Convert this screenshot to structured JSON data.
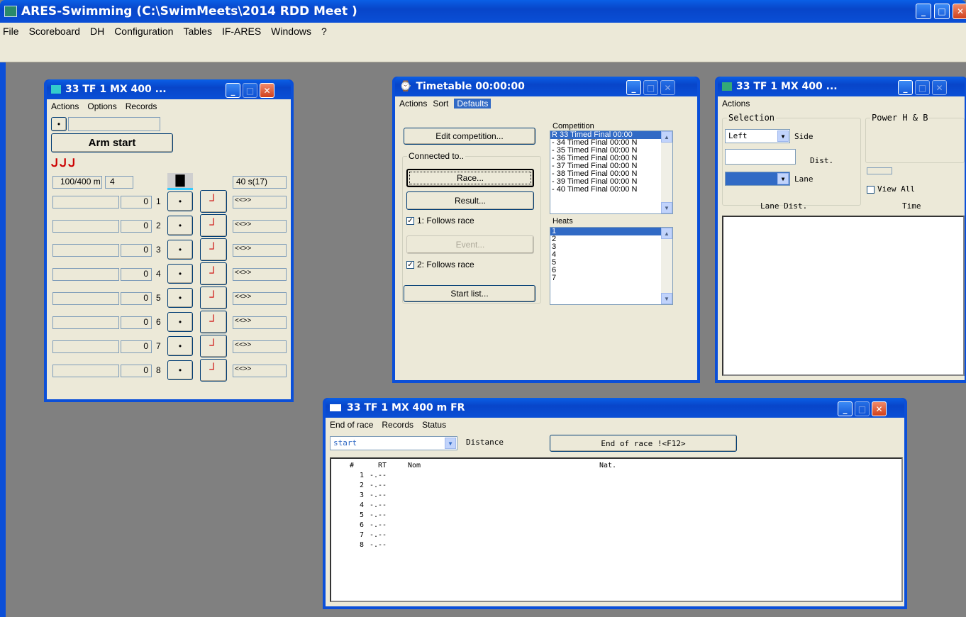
{
  "app": {
    "title": "ARES-Swimming (C:\\SwimMeets\\2014 RDD Meet )",
    "menu": [
      "File",
      "Scoreboard",
      "DH",
      "Configuration",
      "Tables",
      "IF-ARES",
      "Windows",
      "?"
    ]
  },
  "lanes_win": {
    "title": "33  TF 1  MX 400 ...",
    "menu": [
      "Actions",
      "Options",
      "Records"
    ],
    "arm_label": "Arm start",
    "dist": "100/400  m",
    "count": "4",
    "time": "40 s(17)",
    "lanes": [
      {
        "n": "1",
        "v": "0",
        "r": "<<>>"
      },
      {
        "n": "2",
        "v": "0",
        "r": "<<>>"
      },
      {
        "n": "3",
        "v": "0",
        "r": "<<>>"
      },
      {
        "n": "4",
        "v": "0",
        "r": "<<>>"
      },
      {
        "n": "5",
        "v": "0",
        "r": "<<>>"
      },
      {
        "n": "6",
        "v": "0",
        "r": "<<>>"
      },
      {
        "n": "7",
        "v": "0",
        "r": "<<>>"
      },
      {
        "n": "8",
        "v": "0",
        "r": "<<>>"
      }
    ]
  },
  "timetable": {
    "title": "Timetable  00:00:00",
    "menu": [
      "Actions",
      "Sort",
      "Defaults"
    ],
    "edit_btn": "Edit competition...",
    "connected": "Connected to..",
    "race_btn": "Race...",
    "result_btn": "Result...",
    "follows1": "1: Follows race",
    "event_btn": "Event...",
    "follows2": "2: Follows race",
    "start_btn": "Start list...",
    "competition_label": "Competition",
    "competitions": [
      "R 33 Timed Final 00:00",
      "- 34 Timed Final 00:00 N",
      "- 35 Timed Final 00:00 N",
      "- 36 Timed Final 00:00 N",
      "- 37 Timed Final 00:00 N",
      "- 38 Timed Final 00:00 N",
      "- 39 Timed Final 00:00 N",
      "- 40 Timed Final 00:00 N"
    ],
    "heats_label": "Heats",
    "heats": [
      "1",
      "2",
      "3",
      "4",
      "5",
      "6",
      "7"
    ]
  },
  "dist_win": {
    "title": "33  TF 1  MX 400 ...",
    "menu": [
      "Actions"
    ],
    "selection": "Selection",
    "power": "Power H & B",
    "side_val": "Left",
    "side_lbl": "Side",
    "dist_lbl": "Dist.",
    "lane_lbl": "Lane",
    "view_all": "View All",
    "col1": "Lane Dist.",
    "col2": "Time"
  },
  "result_win": {
    "title": "33  TF 1  MX 400 m FR",
    "menu": [
      "End of race",
      "Records",
      "Status"
    ],
    "select_val": "start",
    "distance_lbl": "Distance",
    "end_btn": "End of race  !<F12>",
    "headers": [
      "#",
      "RT",
      "Nom",
      "Nat."
    ],
    "rows": [
      {
        "n": "1",
        "rt": "-.--"
      },
      {
        "n": "2",
        "rt": "-.--"
      },
      {
        "n": "3",
        "rt": "-.--"
      },
      {
        "n": "4",
        "rt": "-.--"
      },
      {
        "n": "5",
        "rt": "-.--"
      },
      {
        "n": "6",
        "rt": "-.--"
      },
      {
        "n": "7",
        "rt": "-.--"
      },
      {
        "n": "8",
        "rt": "-.--"
      }
    ]
  }
}
